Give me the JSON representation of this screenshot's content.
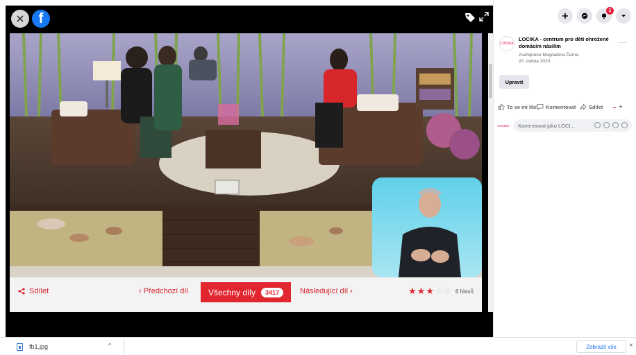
{
  "viewer": {
    "close_icon": "close-icon",
    "fb_logo_letter": "f",
    "tag_icon": "tag-icon",
    "expand_icon": "expand-icon"
  },
  "video_player": {
    "share_label": "Sdílet",
    "prev_label": "‹ Předchozí díl",
    "all_episodes_label": "Všechny díly",
    "all_episodes_count": "3417",
    "next_label": "Následující díl ›",
    "rating": {
      "filled": 3,
      "total": 5
    },
    "rating_count": "6 hlasů"
  },
  "right_panel": {
    "notifications_count": "1",
    "page": {
      "avatar_text": "LOCIKA",
      "name": "LOCIKA - centrum pro děti ohrožené domácím násilím",
      "meta_line1": "Zveřejněno Magdaléna Černá",
      "meta_line2": "20. dubna 2020 ·"
    },
    "more_label": "···",
    "edit_label": "Upravit",
    "actions": {
      "like_label": "To se mi líbí",
      "comment_label": "Komentovat",
      "share_label": "Sdílet"
    },
    "comment_placeholder": "Komentovat jako LOCI..."
  },
  "download_bar": {
    "file_name": "fb1.jpg",
    "show_all_label": "Zobrazit vše",
    "close_label": "×"
  },
  "colors": {
    "accent_red": "#e2262f",
    "facebook_blue": "#1877f2",
    "panel_grey": "#e4e6eb"
  }
}
